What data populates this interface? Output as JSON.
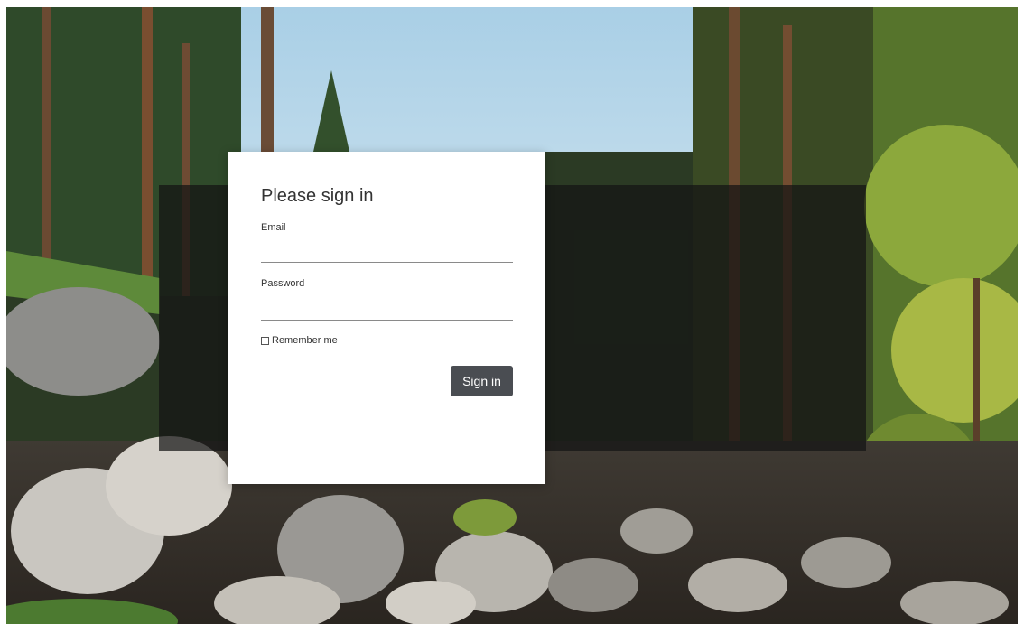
{
  "login": {
    "title": "Please sign in",
    "email_label": "Email",
    "email_value": "",
    "password_label": "Password",
    "password_value": "",
    "remember_label": "Remember me",
    "remember_checked": false,
    "submit_label": "Sign in"
  },
  "colors": {
    "button_bg": "#4a4d52",
    "overlay": "rgba(20,20,20,0.72)",
    "card_bg": "#ffffff"
  },
  "background": {
    "subject": "forest-river-landscape"
  }
}
